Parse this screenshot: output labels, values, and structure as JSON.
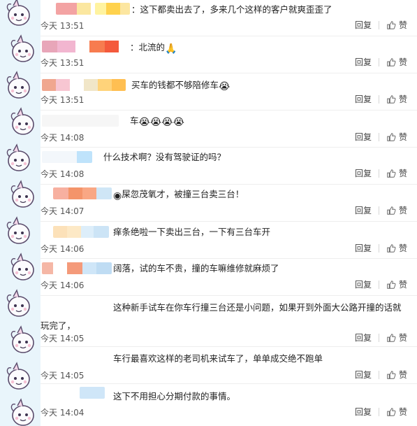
{
  "comments": [
    {
      "text": "：这下都卖出去了，多来几个这样的客户就爽歪歪了",
      "emoji": "",
      "time": "今天 13:51",
      "reply": "回复",
      "like": "赞"
    },
    {
      "text": "：北流的",
      "emoji": "🙏",
      "time": "今天 13:51",
      "reply": "回复",
      "like": "赞"
    },
    {
      "text": "买车的钱都不够陪修车",
      "emoji": "😭",
      "time": "今天 13:51",
      "reply": "回复",
      "like": "赞"
    },
    {
      "text": "车",
      "emoji": "😭😭😭😭",
      "time": "今天 14:08",
      "reply": "回复",
      "like": "赞"
    },
    {
      "text": "什么技术啊？没有驾驶证的吗？",
      "emoji": "",
      "time": "今天 14:08",
      "reply": "回复",
      "like": "赞"
    },
    {
      "text": "屎忽茂氧才，被撞三台卖三台！",
      "emoji": "",
      "time": "今天 14:07",
      "reply": "回复",
      "like": "赞"
    },
    {
      "text": "痒条绝啦一下卖出三台，一下有三台车开",
      "emoji": "",
      "time": "今天 14:06",
      "reply": "回复",
      "like": "赞"
    },
    {
      "text": "阔落，试的车不贵，撞的车嘛维修就麻烦了",
      "emoji": "",
      "time": "今天 14:06",
      "reply": "回复",
      "like": "赞"
    },
    {
      "text": "这种新手试车在你车行撞三台还是小问题，如果开到外面大公路开撞的话就玩完了，",
      "emoji": "",
      "time": "今天 14:05",
      "reply": "回复",
      "like": "赞"
    },
    {
      "text": "车行最喜欢这样的老司机来试车了，单单成交绝不跑单",
      "emoji": "",
      "time": "今天 14:05",
      "reply": "回复",
      "like": "赞"
    },
    {
      "text": "这下不用担心分期付款的事情。",
      "emoji": "",
      "time": "今天 14:04",
      "reply": "回复",
      "like": "赞"
    }
  ],
  "colors": {
    "deco_bg": "#e9f5fb",
    "separator": "#eeeeee",
    "text": "#222222",
    "meta": "#555555"
  }
}
